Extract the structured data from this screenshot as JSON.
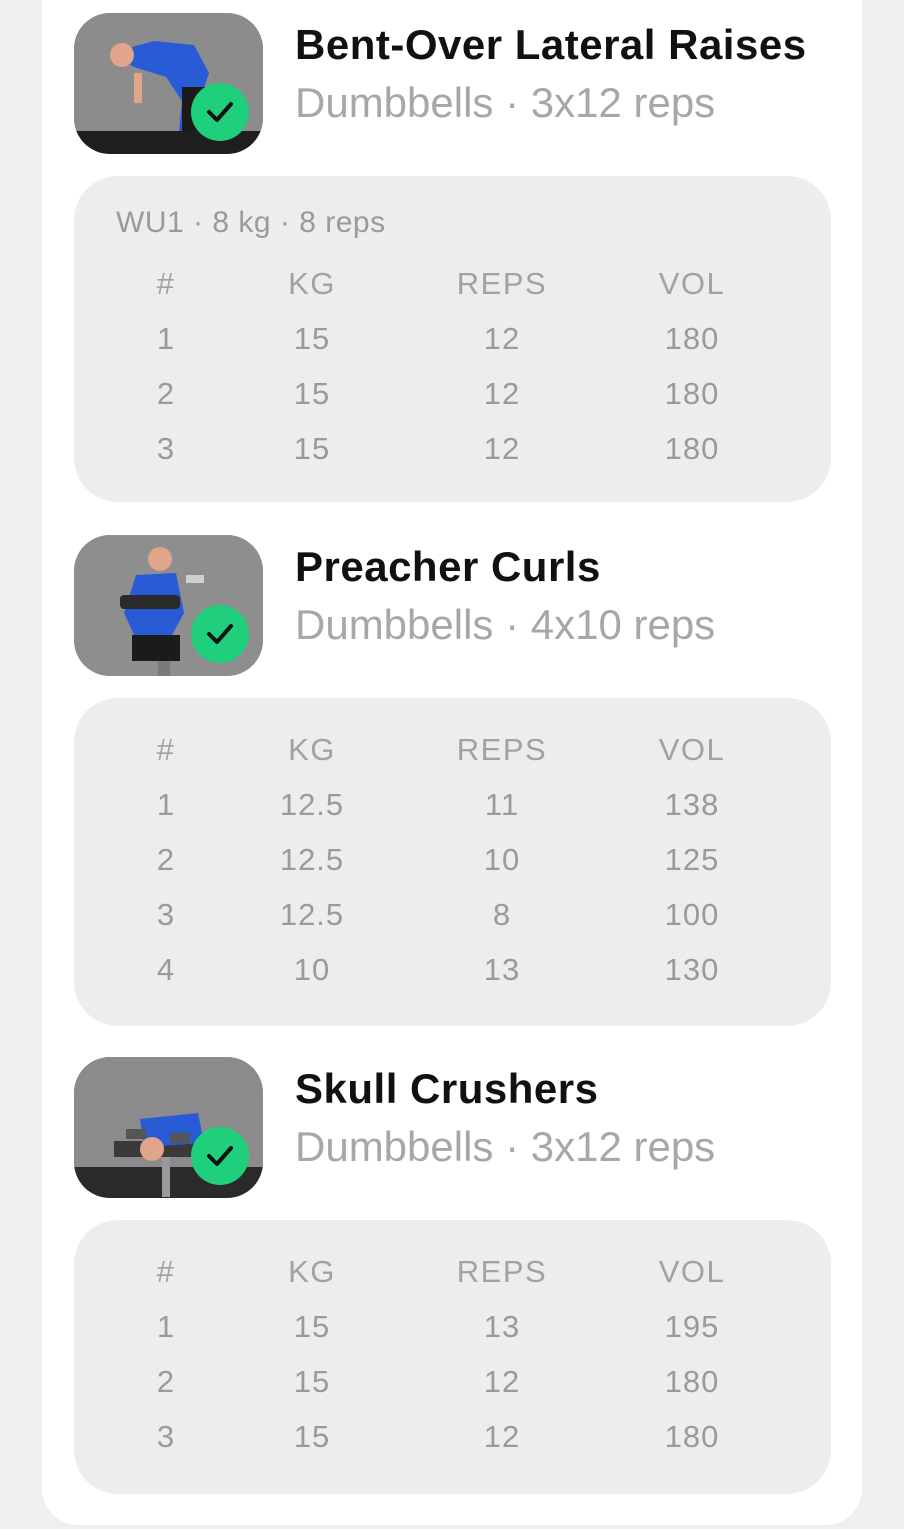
{
  "colors": {
    "background": "#efefef",
    "card": "#ffffff",
    "panel": "#ededed",
    "check_badge": "#1fcf7c",
    "title_text": "#111111",
    "secondary_text": "#a7a7a7"
  },
  "table_headers": [
    "#",
    "KG",
    "REPS",
    "VOL"
  ],
  "exercises": [
    {
      "title": "Bent-Over Lateral Raises",
      "subtitle": "Dumbbells · 3x12 reps",
      "completed": true,
      "check_icon": "check-icon",
      "warmup": "WU1 · 8 kg · 8 reps",
      "sets": [
        [
          "1",
          "15",
          "12",
          "180"
        ],
        [
          "2",
          "15",
          "12",
          "180"
        ],
        [
          "3",
          "15",
          "12",
          "180"
        ]
      ]
    },
    {
      "title": "Preacher Curls",
      "subtitle": "Dumbbells · 4x10 reps",
      "completed": true,
      "check_icon": "check-icon",
      "sets": [
        [
          "1",
          "12.5",
          "11",
          "138"
        ],
        [
          "2",
          "12.5",
          "10",
          "125"
        ],
        [
          "3",
          "12.5",
          "8",
          "100"
        ],
        [
          "4",
          "10",
          "13",
          "130"
        ]
      ]
    },
    {
      "title": "Skull Crushers",
      "subtitle": "Dumbbells · 3x12 reps",
      "completed": true,
      "check_icon": "check-icon",
      "sets": [
        [
          "1",
          "15",
          "13",
          "195"
        ],
        [
          "2",
          "15",
          "12",
          "180"
        ],
        [
          "3",
          "15",
          "12",
          "180"
        ]
      ]
    }
  ]
}
